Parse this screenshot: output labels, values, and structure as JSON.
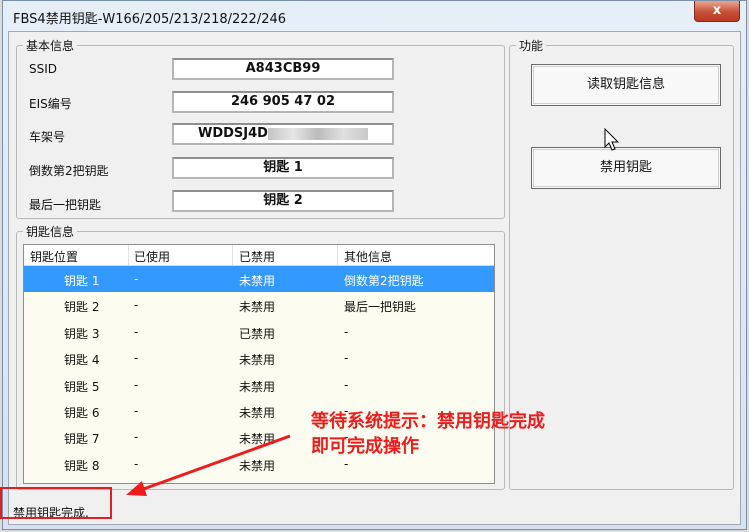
{
  "window": {
    "title": "FBS4禁用钥匙-W166/205/213/218/222/246",
    "close_glyph": "x"
  },
  "basic_info": {
    "legend": "基本信息",
    "ssid_label": "SSID",
    "ssid_value": "A843CB99",
    "eis_label": "EIS编号",
    "eis_value": "246 905 47 02",
    "vin_label": "车架号",
    "vin_value": "WDDSJ4D",
    "second_last_label": "倒数第2把钥匙",
    "second_last_value": "钥匙 1",
    "last_label": "最后一把钥匙",
    "last_value": "钥匙 2"
  },
  "function": {
    "legend": "功能",
    "read_button": "读取钥匙信息",
    "disable_button": "禁用钥匙"
  },
  "key_info": {
    "legend": "钥匙信息",
    "columns": [
      "钥匙位置",
      "已使用",
      "已禁用",
      "其他信息"
    ],
    "rows": [
      {
        "pos": "钥匙 1",
        "used": "-",
        "disabled": "未禁用",
        "other": "倒数第2把钥匙"
      },
      {
        "pos": "钥匙 2",
        "used": "-",
        "disabled": "未禁用",
        "other": "最后一把钥匙"
      },
      {
        "pos": "钥匙 3",
        "used": "-",
        "disabled": "已禁用",
        "other": "-"
      },
      {
        "pos": "钥匙 4",
        "used": "-",
        "disabled": "未禁用",
        "other": "-"
      },
      {
        "pos": "钥匙 5",
        "used": "-",
        "disabled": "未禁用",
        "other": "-"
      },
      {
        "pos": "钥匙 6",
        "used": "-",
        "disabled": "未禁用",
        "other": "-"
      },
      {
        "pos": "钥匙 7",
        "used": "-",
        "disabled": "未禁用",
        "other": "-"
      },
      {
        "pos": "钥匙 8",
        "used": "-",
        "disabled": "未禁用",
        "other": "-"
      }
    ]
  },
  "status": {
    "text": "禁用钥匙完成."
  },
  "annotation": {
    "line1": "等待系统提示：禁用钥匙完成",
    "line2": "即可完成操作",
    "color": "#ee1c1c"
  },
  "colors": {
    "selection": "#3399ff",
    "list_background": "#fcfcf0"
  }
}
